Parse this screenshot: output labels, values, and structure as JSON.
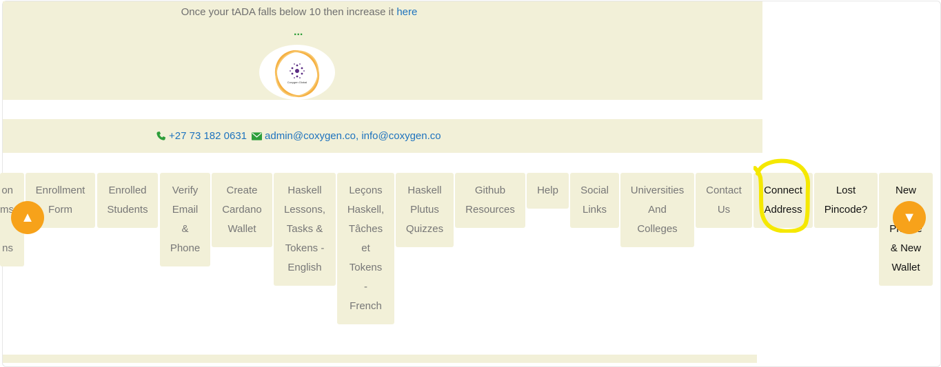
{
  "banner": {
    "notice_text": "Once your tADA falls below 10 then increase it",
    "notice_link": "here",
    "ellipsis": "...",
    "logo_text": "Coxygen Global"
  },
  "contact": {
    "phone": "+27 73 182 0631",
    "emails": "admin@coxygen.co, info@coxygen.co"
  },
  "menu": {
    "items": [
      {
        "lines": [
          "on",
          "ms",
          "",
          "ns"
        ]
      },
      {
        "lines": [
          "Enrollment",
          "Form"
        ]
      },
      {
        "lines": [
          "Enrolled",
          "Students"
        ]
      },
      {
        "lines": [
          "Verify",
          "Email",
          "&",
          "Phone"
        ]
      },
      {
        "lines": [
          "Create",
          "Cardano",
          "Wallet"
        ]
      },
      {
        "lines": [
          "Haskell",
          "Lessons,",
          "Tasks &",
          "Tokens -",
          "English"
        ]
      },
      {
        "lines": [
          "Leçons",
          "Haskell,",
          "Tâches",
          "et",
          "Tokens",
          "-",
          "French"
        ]
      },
      {
        "lines": [
          "Haskell",
          "Plutus",
          "Quizzes"
        ]
      },
      {
        "lines": [
          "Github",
          "Resources"
        ]
      },
      {
        "lines": [
          "Help"
        ]
      },
      {
        "lines": [
          "Social",
          "Links"
        ]
      },
      {
        "lines": [
          "Universities",
          "And",
          "Colleges"
        ]
      },
      {
        "lines": [
          "Contact",
          "Us"
        ]
      },
      {
        "lines": [
          "Connect",
          "Address"
        ]
      },
      {
        "lines": [
          "Lost",
          "Pincode?"
        ]
      },
      {
        "lines": [
          "New",
          "",
          "Phrase",
          "& New",
          "Wallet"
        ]
      }
    ]
  },
  "scroll": {
    "up_icon": "▲",
    "down_icon": "▼"
  },
  "colors": {
    "banner_bg": "#f2f0d8",
    "link": "#1e73be",
    "scroll_button": "#f7a21a",
    "highlight": "#f5e800"
  }
}
